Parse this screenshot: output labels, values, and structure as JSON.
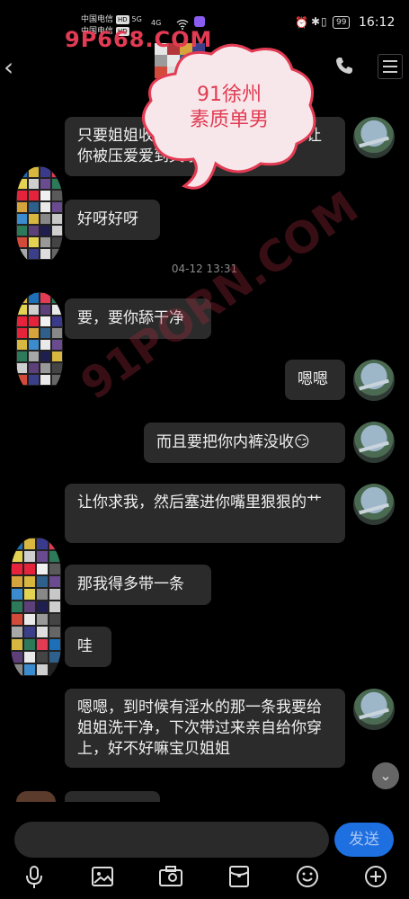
{
  "status_bar": {
    "carrier1": "中国电信",
    "carrier2": "中国电信",
    "hd": "HD",
    "net1": "5G",
    "net2": "4G",
    "battery": "99",
    "time": "16:12"
  },
  "watermark": {
    "site": "9P668.COM",
    "diagonal": "91PORN.COM",
    "cloud_line1": "91徐州",
    "cloud_line2": "素质单男"
  },
  "messages": [
    {
      "side": "right",
      "text": "只要姐姐收的开，小狗就没问题，让你被压爱爱到哭哦"
    },
    {
      "side": "left",
      "text": "好呀好呀"
    },
    {
      "side": "left",
      "text": "要，要你舔干净"
    },
    {
      "side": "right",
      "text": "嗯嗯"
    },
    {
      "side": "right",
      "text": "而且要把你内裤没收😏"
    },
    {
      "side": "right",
      "text": "让你求我，然后塞进你嘴里狠狠的艹"
    },
    {
      "side": "left",
      "text": "那我得多带一条"
    },
    {
      "side": "left",
      "text": "哇"
    },
    {
      "side": "right",
      "text": "嗯嗯，到时候有淫水的那一条我要给姐姐洗干净，下次带过来亲自给你穿上，好不好嘛宝贝姐姐"
    }
  ],
  "timestamp": "04-12 13:31",
  "input": {
    "send_label": "发送"
  },
  "icons": {
    "back": "back-arrow-icon",
    "call": "phone-icon",
    "menu": "menu-icon",
    "voice": "microphone-icon",
    "image": "image-icon",
    "camera": "camera-icon",
    "gift": "red-packet-icon",
    "emoji": "emoji-icon",
    "plus": "plus-icon"
  }
}
